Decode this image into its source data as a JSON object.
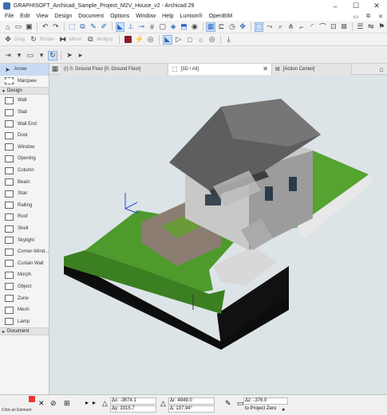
{
  "window": {
    "title": "GRAPHISOFT_Archicad_Sample_Project_M2V_House_v2 - Archicad 29",
    "controls": [
      "–",
      "☐",
      "✕"
    ]
  },
  "menubar": {
    "items": [
      "File",
      "Edit",
      "View",
      "Design",
      "Document",
      "Options",
      "Window",
      "Help",
      "Lumion®",
      "OpenBIM"
    ]
  },
  "toolbar2": {
    "drag_label": "Drag",
    "rotate_label": "Rotate",
    "mirror_label": "Mirror",
    "multiply_label": "Multiply"
  },
  "tabs": [
    {
      "label": "(!) 0. Ground Floor [0. Ground Floor]"
    },
    {
      "label": "[3D / All]"
    },
    {
      "label": "[Action Center]"
    }
  ],
  "palette": {
    "top_items": [
      "Arrow",
      "Marquee"
    ],
    "design_header": "Design",
    "design_items": [
      "Wall",
      "Slab",
      "Wall End",
      "Door",
      "Window",
      "Opening",
      "Column",
      "Beam",
      "Stair",
      "Railing",
      "Roof",
      "Shell",
      "Skylight",
      "Corner-Wind...",
      "Curtain Wall",
      "Morph",
      "Object",
      "Zone",
      "Mesh",
      "Lamp"
    ],
    "document_header": "Document"
  },
  "status": {
    "ax": "Δx: -3674.1",
    "ay": "Δy: 3315.7",
    "ar": "Δr: 4949.0",
    "aangle": "Δ: 137.94°",
    "az": "Δz: -376.0",
    "zref": "to Project Zero",
    "hint": "Click an Element"
  }
}
